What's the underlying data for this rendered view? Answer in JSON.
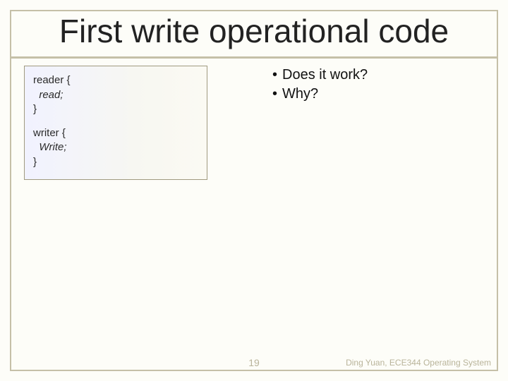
{
  "title": "First write operational code",
  "code": {
    "reader": {
      "header": "reader {",
      "body": "read;",
      "close": "}"
    },
    "writer": {
      "header": "writer {",
      "body": "Write;",
      "close": "}"
    }
  },
  "questions": [
    "Does it work?",
    "Why?"
  ],
  "page_number": "19",
  "attribution": "Ding Yuan, ECE344 Operating System"
}
